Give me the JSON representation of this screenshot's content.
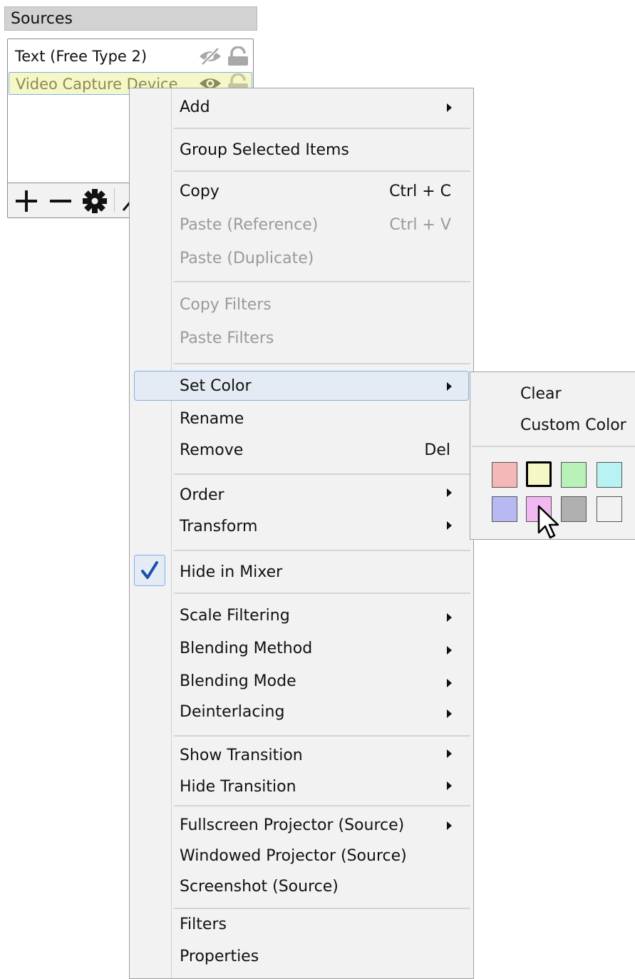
{
  "sources": {
    "title": "Sources",
    "items": [
      {
        "name": "Text (Free Type 2)",
        "visibility_icon": "eye-slash-icon",
        "lock_icon": "lock-icon"
      },
      {
        "name": "Video Capture Device",
        "visibility_icon": "eye-icon",
        "lock_icon": "lock-icon",
        "selected": true,
        "highlight_color": "#f6f7c6"
      }
    ],
    "toolbar": [
      "add-icon",
      "remove-icon",
      "gear-icon",
      "up-icon"
    ]
  },
  "context_menu": {
    "add": "Add",
    "group_selected": "Group Selected Items",
    "copy": "Copy",
    "copy_shortcut": "Ctrl + C",
    "paste_reference": "Paste (Reference)",
    "paste_reference_shortcut": "Ctrl + V",
    "paste_duplicate": "Paste (Duplicate)",
    "copy_filters": "Copy Filters",
    "paste_filters": "Paste Filters",
    "set_color": "Set Color",
    "rename": "Rename",
    "remove": "Remove",
    "remove_shortcut": "Del",
    "order": "Order",
    "transform": "Transform",
    "hide_in_mixer": "Hide in Mixer",
    "hide_in_mixer_checked": true,
    "scale_filtering": "Scale Filtering",
    "blending_method": "Blending Method",
    "blending_mode": "Blending Mode",
    "deinterlacing": "Deinterlacing",
    "show_transition": "Show Transition",
    "hide_transition": "Hide Transition",
    "fullscreen_projector": "Fullscreen Projector (Source)",
    "windowed_projector": "Windowed Projector (Source)",
    "screenshot": "Screenshot (Source)",
    "filters": "Filters",
    "properties": "Properties"
  },
  "color_submenu": {
    "clear": "Clear",
    "custom_color": "Custom Color",
    "swatches": [
      "#f5b8b8",
      "#f6f7c6",
      "#b8f2b8",
      "#b8f2f2",
      "#b8b8f2",
      "#f2b8f2",
      "#b0b0b0",
      "#f2f2f2"
    ],
    "selected_swatch": 1
  }
}
